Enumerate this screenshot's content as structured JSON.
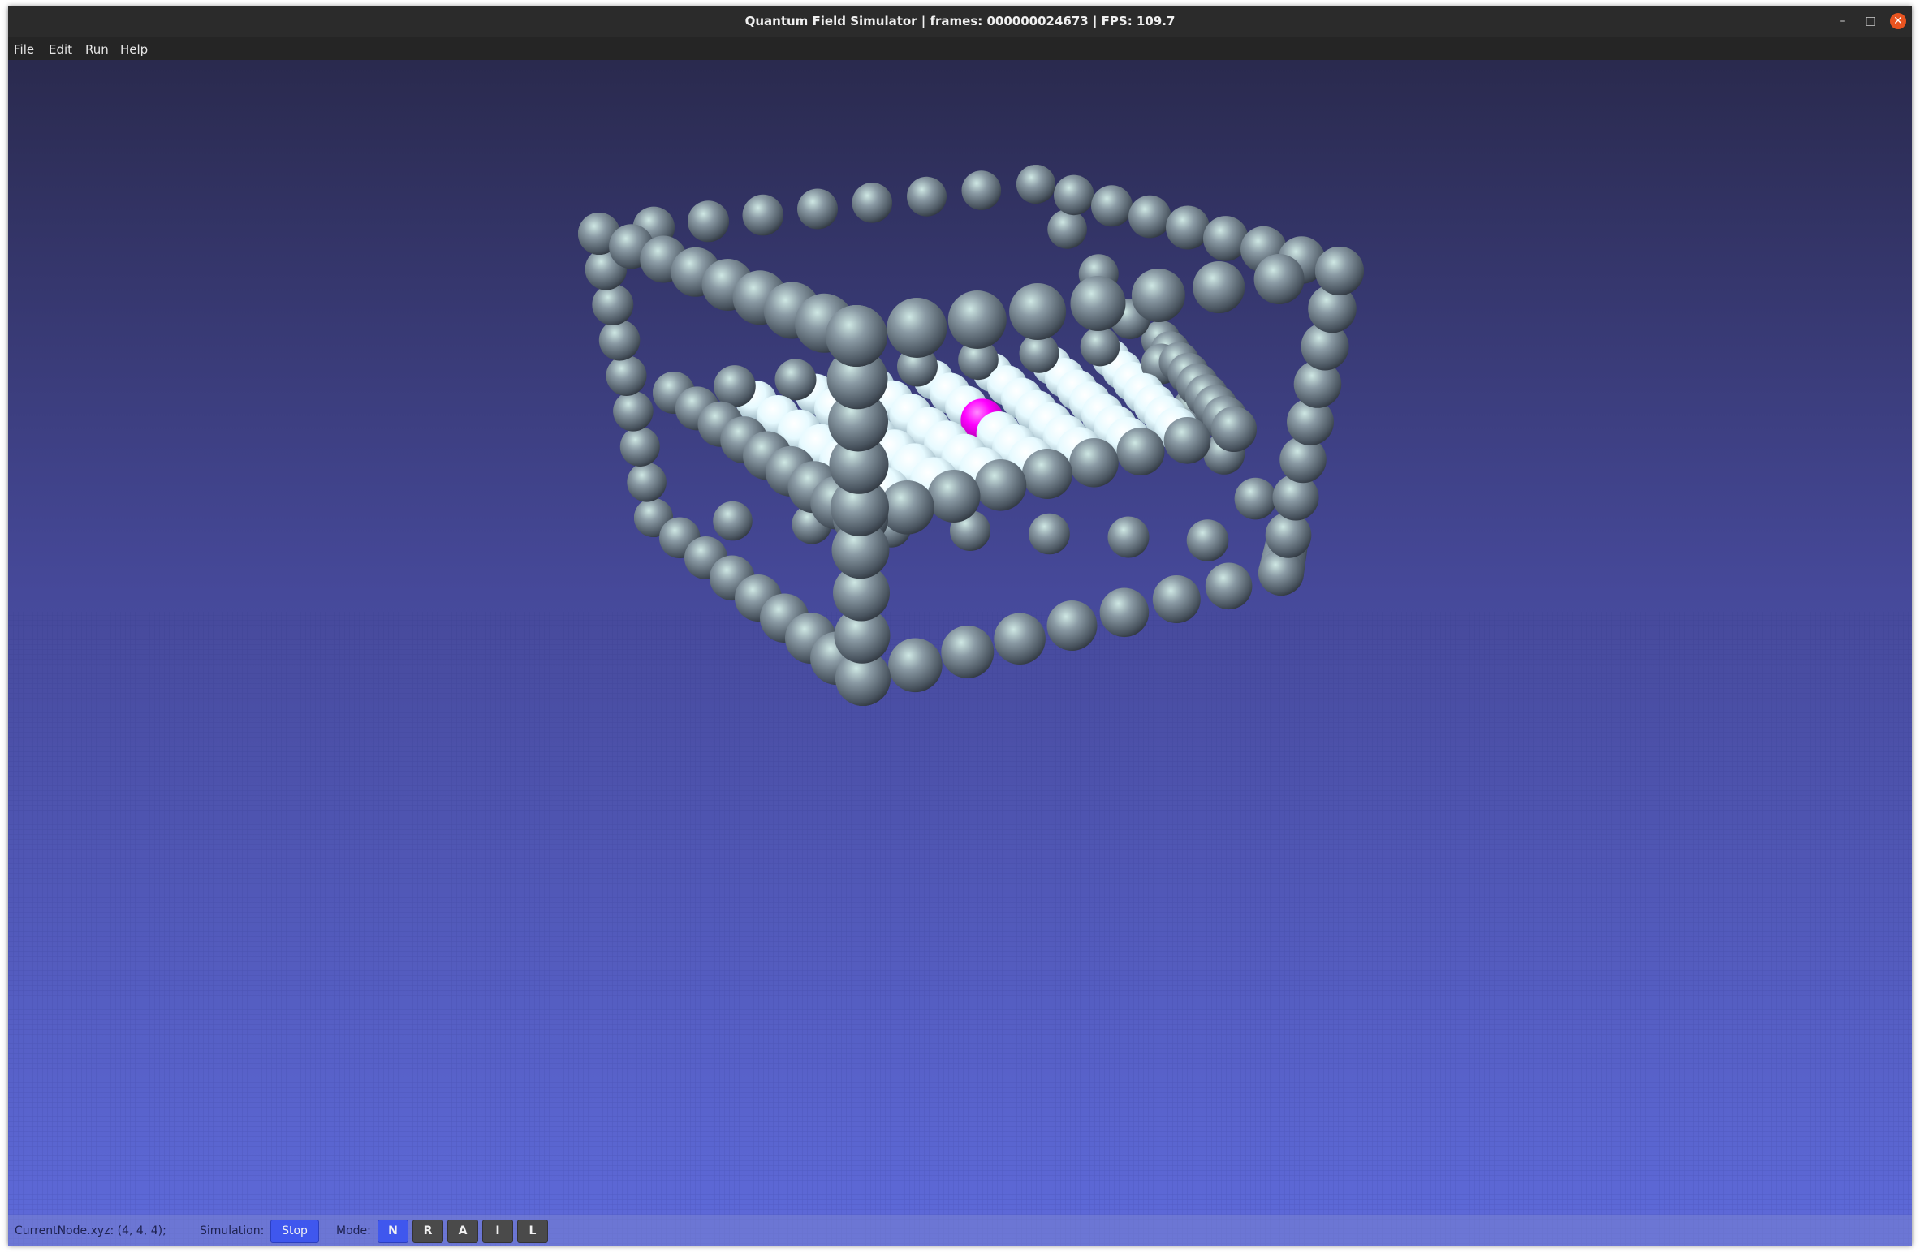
{
  "window": {
    "title": "Quantum Field Simulator  | frames: 000000024673 | FPS: 109.7",
    "controls": {
      "minimize": "–",
      "maximize": "□",
      "close": "✕"
    }
  },
  "menu": {
    "items": [
      "File",
      "Edit",
      "Run",
      "Help"
    ]
  },
  "scene": {
    "description_icon": "sphere-lattice",
    "colors": {
      "background_top": "#2a2a4e",
      "background_bottom": "#5a66d6",
      "edge_sphere": "#7d8a96",
      "face_sphere": "#e8fbff",
      "selected_node": "#ff00ff"
    }
  },
  "status": {
    "current_node": "CurrentNode.xyz: (4, 4, 4);",
    "simulation_label": "Simulation:",
    "simulation_button": "Stop",
    "mode_label": "Mode:",
    "modes": [
      "N",
      "R",
      "A",
      "I",
      "L"
    ],
    "active_mode": "N"
  }
}
